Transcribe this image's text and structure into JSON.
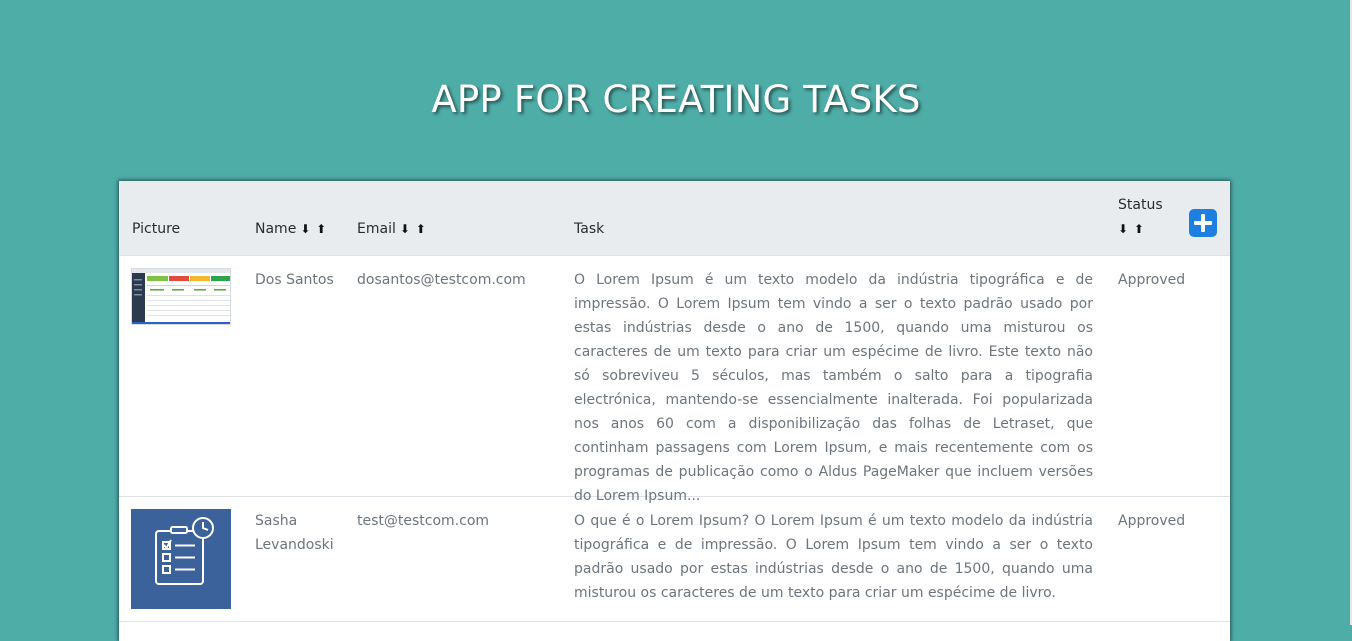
{
  "page": {
    "title": "APP FOR CREATING TASKS",
    "background_color": "#4fada8"
  },
  "table": {
    "columns": {
      "picture": "Picture",
      "name": "Name",
      "email": "Email",
      "task": "Task",
      "status": "Status"
    },
    "sort_label": "⬇ ⬆",
    "add_button_color": "#1d7fe0",
    "add_button_icon": "plus-icon",
    "rows": [
      {
        "picture": "dashboard-screenshot-thumbnail",
        "name": "Dos Santos",
        "email": "dosantos@testcom.com",
        "task": "O Lorem Ipsum é um texto modelo da indústria tipográfica e de impressão. O Lorem Ipsum tem vindo a ser o texto padrão usado por estas indústrias desde o ano de 1500, quando uma misturou os caracteres de um texto para criar um espécime de livro. Este texto não só sobreviveu 5 séculos, mas também o salto para a tipografia electrónica, mantendo-se essencialmente inalterada. Foi popularizada nos anos 60 com a disponibilização das folhas de Letraset, que continham passagens com Lorem Ipsum, e mais recentemente com os programas de publicação como o Aldus PageMaker que incluem versões do Lorem Ipsum...",
        "status": "Approved"
      },
      {
        "picture": "task-checklist-clock-icon",
        "name": "Sasha Levandoski",
        "email": "test@testcom.com",
        "task": "O que é o Lorem Ipsum? O Lorem Ipsum é um texto modelo da indústria tipográfica e de impressão. O Lorem Ipsum tem vindo a ser o texto padrão usado por estas indústrias desde o ano de 1500, quando uma misturou os caracteres de um texto para criar um espécime de livro.",
        "status": "Approved"
      }
    ]
  }
}
